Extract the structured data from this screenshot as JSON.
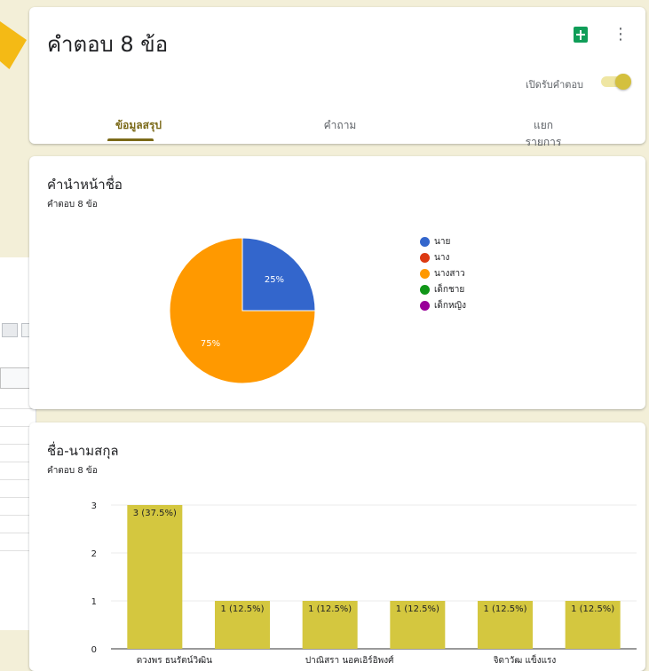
{
  "header": {
    "title": "คำตอบ 8 ข้อ",
    "accepting_label": "เปิดรับคำตอบ",
    "more_glyph": "⋮",
    "tabs": [
      {
        "label": "ข้อมูลสรุป",
        "active": true
      },
      {
        "label": "คำถาม",
        "active": false
      },
      {
        "label": "แยกรายการ",
        "active": false
      }
    ]
  },
  "pie_card": {
    "title": "คำนำหน้าชื่อ",
    "subtitle": "คำตอบ 8 ข้อ"
  },
  "bar_card": {
    "title": "ชื่อ-นามสกุล",
    "subtitle": "คำตอบ 8 ข้อ"
  },
  "colors": {
    "accent": "#7b6a19",
    "bar": "#d4c73f",
    "pie_blue": "#3366cc",
    "pie_red": "#dc3912",
    "pie_orange": "#ff9900",
    "pie_green": "#109618",
    "pie_purple": "#990099",
    "background": "#f3efd8"
  },
  "chart_data": [
    {
      "type": "pie",
      "categories": [
        "นาย",
        "นาง",
        "นางสาว",
        "เด็กชาย",
        "เด็กหญิง"
      ],
      "values": [
        2,
        0,
        6,
        0,
        0
      ],
      "labels": [
        "25%",
        "",
        "75%",
        "",
        ""
      ],
      "colors": [
        "#3366cc",
        "#dc3912",
        "#ff9900",
        "#109618",
        "#990099"
      ],
      "legend_position": "right"
    },
    {
      "type": "bar",
      "categories": [
        "ดวงพร ธนรัตน์วิฒิน",
        "",
        "ปาณิสรา นอคเอิร์อิพงศ์",
        "",
        "จิดาวัฒ แข็งแรง",
        ""
      ],
      "values": [
        3,
        1,
        1,
        1,
        1,
        1
      ],
      "labels": [
        "3 (37.5%)",
        "1 (12.5%)",
        "1 (12.5%)",
        "1 (12.5%)",
        "1 (12.5%)",
        "1 (12.5%)"
      ],
      "y_ticks": [
        "0",
        "1",
        "2",
        "3"
      ],
      "ylim": [
        0,
        3
      ],
      "grid": true
    }
  ]
}
